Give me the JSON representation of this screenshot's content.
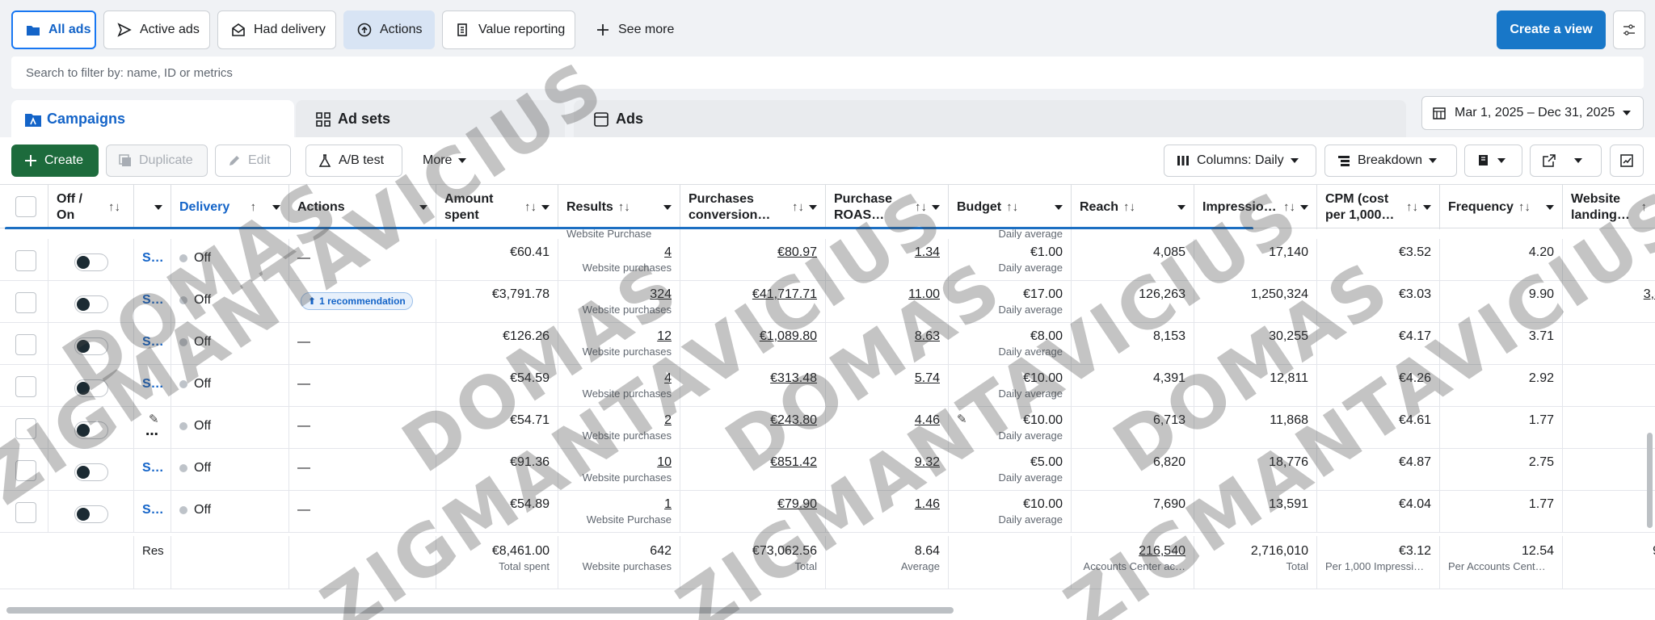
{
  "views": {
    "all_ads": "All ads",
    "active_ads": "Active ads",
    "had_delivery": "Had delivery",
    "actions": "Actions",
    "value_reporting": "Value reporting",
    "see_more": "See more",
    "create_view": "Create a view"
  },
  "search": {
    "placeholder": "Search to filter by: name, ID or metrics"
  },
  "levels": {
    "campaigns": "Campaigns",
    "ad_sets": "Ad sets",
    "ads": "Ads"
  },
  "date_range": "Mar 1, 2025 – Dec 31, 2025",
  "toolbar": {
    "create": "Create",
    "duplicate": "Duplicate",
    "edit": "Edit",
    "ab_test": "A/B test",
    "more": "More",
    "columns": "Columns: Daily",
    "breakdown": "Breakdown"
  },
  "columns": {
    "off_on": "Off / On",
    "delivery": "Delivery",
    "actions": "Actions",
    "amount_spent": "Amount spent",
    "results": "Results",
    "purchases_conv": "Purchases conversion…",
    "purchase_roas": "Purchase ROAS…",
    "budget": "Budget",
    "reach": "Reach",
    "impressions": "Impressio…",
    "cpm": "CPM (cost per 1,000…",
    "frequency": "Frequency",
    "website_landing": "Website landing…"
  },
  "partial": {
    "results_top": "Website Purchase",
    "budget_top": "Daily average"
  },
  "rows": [
    {
      "name": "S…",
      "delivery": "Off",
      "action": "—",
      "spent": "€60.41",
      "results": "4",
      "results_sub": "Website purchases",
      "conv": "€80.97",
      "roas": "1.34",
      "budget": "€1.00",
      "budget_sub": "Daily average",
      "reach": "4,085",
      "impr": "17,140",
      "cpm": "€3.52",
      "freq": "4.20",
      "land": ""
    },
    {
      "name": "S…",
      "delivery": "Off",
      "action": "1 recommendation",
      "spent": "€3,791.78",
      "results": "324",
      "results_sub": "Website purchases",
      "conv": "€41,717.71",
      "roas": "11.00",
      "budget": "€17.00",
      "budget_sub": "Daily average",
      "reach": "126,263",
      "impr": "1,250,324",
      "cpm": "€3.03",
      "freq": "9.90",
      "land": "3,3"
    },
    {
      "name": "S…",
      "delivery": "Off",
      "action": "—",
      "spent": "€126.26",
      "results": "12",
      "results_sub": "Website purchases",
      "conv": "€1,089.80",
      "roas": "8.63",
      "budget": "€8.00",
      "budget_sub": "Daily average",
      "reach": "8,153",
      "impr": "30,255",
      "cpm": "€4.17",
      "freq": "3.71",
      "land": ""
    },
    {
      "name": "S…",
      "delivery": "Off",
      "action": "—",
      "spent": "€54.59",
      "results": "4",
      "results_sub": "Website purchases",
      "conv": "€313.48",
      "roas": "5.74",
      "budget": "€10.00",
      "budget_sub": "Daily average",
      "reach": "4,391",
      "impr": "12,811",
      "cpm": "€4.26",
      "freq": "2.92",
      "land": ""
    },
    {
      "name": "",
      "delivery": "Off",
      "action": "—",
      "spent": "€54.71",
      "results": "2",
      "results_sub": "Website purchases",
      "conv": "€243.80",
      "roas": "4.46",
      "budget": "€10.00",
      "budget_sub": "Daily average",
      "reach": "6,713",
      "impr": "11,868",
      "cpm": "€4.61",
      "freq": "1.77",
      "land": ""
    },
    {
      "name": "S…",
      "delivery": "Off",
      "action": "—",
      "spent": "€91.36",
      "results": "10",
      "results_sub": "Website purchases",
      "conv": "€851.42",
      "roas": "9.32",
      "budget": "€5.00",
      "budget_sub": "Daily average",
      "reach": "6,820",
      "impr": "18,776",
      "cpm": "€4.87",
      "freq": "2.75",
      "land": ""
    },
    {
      "name": "S…",
      "delivery": "Off",
      "action": "—",
      "spent": "€54.89",
      "results": "1",
      "results_sub": "Website Purchase",
      "conv": "€79.90",
      "roas": "1.46",
      "budget": "€10.00",
      "budget_sub": "Daily average",
      "reach": "7,690",
      "impr": "13,591",
      "cpm": "€4.04",
      "freq": "1.77",
      "land": ""
    }
  ],
  "totals": {
    "label": "Res",
    "spent": "€8,461.00",
    "spent_sub": "Total spent",
    "results": "642",
    "results_sub": "Website purchases",
    "conv": "€73,062.56",
    "conv_sub": "Total",
    "roas": "8.64",
    "roas_sub": "Average",
    "reach": "216,540",
    "reach_sub": "Accounts Center ac…",
    "impr": "2,716,010",
    "impr_sub": "Total",
    "cpm": "€3.12",
    "cpm_sub": "Per 1,000 Impressi…",
    "freq": "12.54",
    "freq_sub": "Per Accounts Cent…",
    "land": "9"
  },
  "watermark": {
    "line1": "DOMAS",
    "line2": "ZIGMANTAVICIUS"
  }
}
